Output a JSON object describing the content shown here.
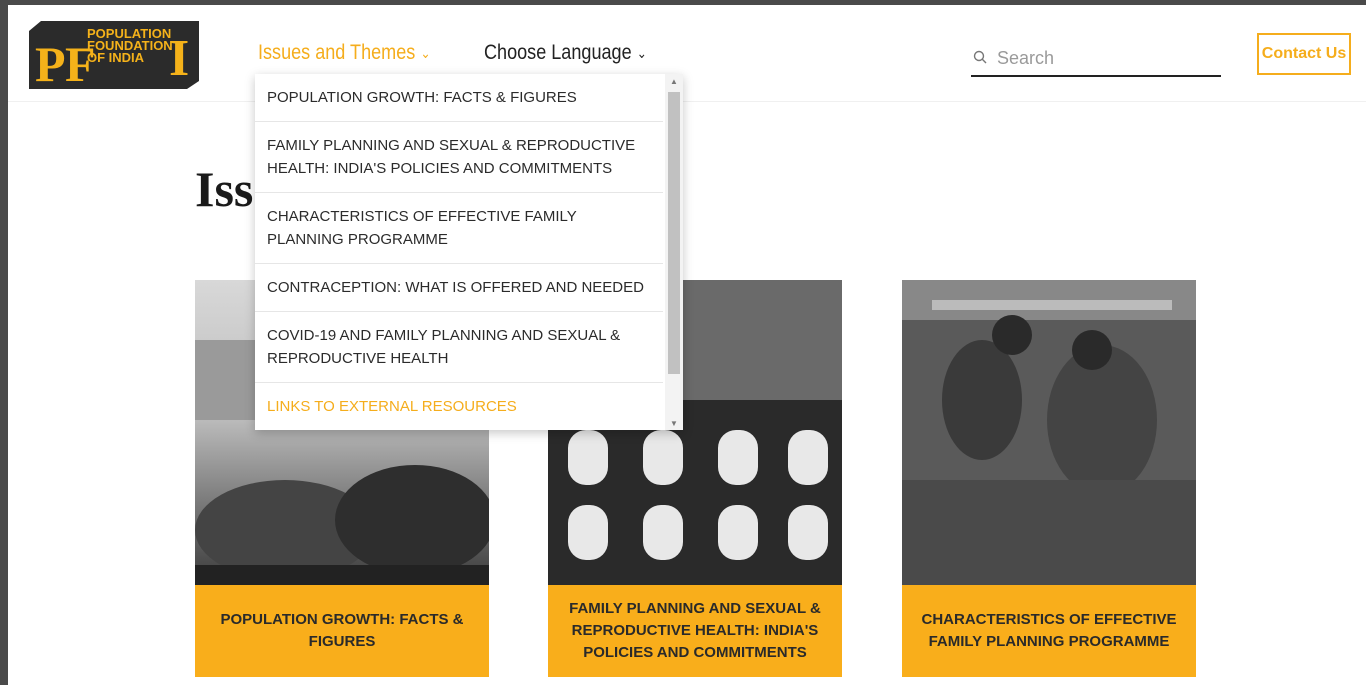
{
  "logo": {
    "lines": [
      "POPULATION",
      "FOUNDATION",
      "OF INDIA"
    ],
    "letters": "P F I"
  },
  "nav": {
    "issues_label": "Issues and Themes",
    "language_label": "Choose Language"
  },
  "search": {
    "placeholder": "Search"
  },
  "contact_label": "Contact Us",
  "page_title": "Iss",
  "dropdown": {
    "items": [
      "POPULATION GROWTH: FACTS & FIGURES",
      "FAMILY PLANNING AND SEXUAL & REPRODUCTIVE HEALTH: INDIA'S POLICIES AND COMMITMENTS",
      "CHARACTERISTICS OF EFFECTIVE FAMILY PLANNING PROGRAMME",
      "CONTRACEPTION: WHAT IS OFFERED AND NEEDED",
      "COVID-19 AND FAMILY PLANNING AND SEXUAL & REPRODUCTIVE HEALTH",
      "LINKS TO EXTERNAL RESOURCES"
    ]
  },
  "cards": [
    {
      "caption": "POPULATION GROWTH: FACTS & FIGURES"
    },
    {
      "caption": "FAMILY PLANNING AND SEXUAL & REPRODUCTIVE HEALTH: INDIA'S POLICIES AND COMMITMENTS"
    },
    {
      "caption": "CHARACTERISTICS OF EFFECTIVE FAMILY PLANNING PROGRAMME"
    }
  ],
  "colors": {
    "accent": "#f5ad1c",
    "card_caption_bg": "#f9ae1b",
    "logo_bg": "#2b2b2b"
  }
}
